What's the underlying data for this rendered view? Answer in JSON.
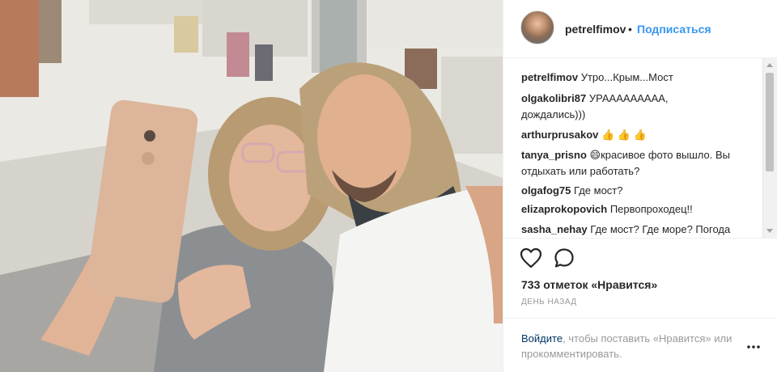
{
  "post": {
    "username": "petrelfimov",
    "separator": "•",
    "follow_label": "Подписаться"
  },
  "comments": [
    {
      "user": "petrelfimov",
      "text": "Утро...Крым...Мост"
    },
    {
      "user": "olgakolibri87",
      "text": "УРААААААААА,"
    },
    {
      "user": "",
      "text": "дождались)))"
    },
    {
      "user": "arthurprusakov",
      "text": "👍 👍 👍"
    },
    {
      "user": "tanya_prisno",
      "text": "😄красивое фото вышло. Вы"
    },
    {
      "user": "",
      "text": "отдыхать или работать?"
    },
    {
      "user": "olgafog75",
      "text": "Где мост?"
    },
    {
      "user": "elizaprokopovich",
      "text": "Первопроходец!!"
    },
    {
      "user": "sasha_nehay",
      "text": "Где мост? Где море? Погода"
    }
  ],
  "stats": {
    "likes_text": "733 отметок «Нравится»",
    "time_text": "день назад"
  },
  "footer": {
    "login_link": "Войдите",
    "login_text": ", чтобы поставить «Нравится» или прокомментировать."
  },
  "icons": {
    "like": "heart-icon",
    "comment": "speech-bubble-icon",
    "more": "more-icon"
  },
  "colors": {
    "link": "#3897f0",
    "login_link": "#003569",
    "muted": "#999999"
  }
}
